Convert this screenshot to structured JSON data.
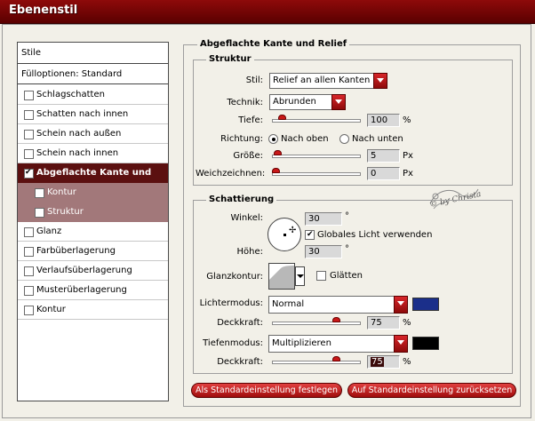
{
  "window": {
    "title": "Ebenenstil"
  },
  "colors": {
    "accent": "#8e0a0a",
    "selected_row": "#5b1010",
    "sub_row": "#a2787a",
    "highlight_color": "#1b2f8a",
    "shadow_color": "#000000"
  },
  "sidebar": {
    "items": [
      {
        "label": "Stile"
      },
      {
        "label": "Fülloptionen: Standard"
      },
      {
        "label": "Schlagschatten",
        "checked": false
      },
      {
        "label": "Schatten nach innen",
        "checked": false
      },
      {
        "label": "Schein nach außen",
        "checked": false
      },
      {
        "label": "Schein nach innen",
        "checked": false
      },
      {
        "label": "Abgeflachte Kante und Relief",
        "checked": true
      },
      {
        "label": "Kontur",
        "checked": false
      },
      {
        "label": "Struktur",
        "checked": false
      },
      {
        "label": "Glanz",
        "checked": false
      },
      {
        "label": "Farbüberlagerung",
        "checked": false
      },
      {
        "label": "Verlaufsüberlagerung",
        "checked": false
      },
      {
        "label": "Musterüberlagerung",
        "checked": false
      },
      {
        "label": "Kontur",
        "checked": false
      }
    ]
  },
  "panel": {
    "title": "Abgeflachte Kante und Relief",
    "structure": {
      "title": "Struktur",
      "style_label": "Stil:",
      "style_value": "Relief an allen Kanten",
      "technique_label": "Technik:",
      "technique_value": "Abrunden",
      "depth_label": "Tiefe:",
      "depth_value": "100",
      "depth_unit": "%",
      "depth_level": 0.08,
      "direction_label": "Richtung:",
      "direction_up": "Nach oben",
      "direction_down": "Nach unten",
      "size_label": "Größe:",
      "size_value": "5",
      "size_unit": "Px",
      "size_level": 0.02,
      "soften_label": "Weichzeichnen:",
      "soften_value": "0",
      "soften_unit": "Px",
      "soften_level": 0.0
    },
    "shading": {
      "title": "Schattierung",
      "angle_label": "Winkel:",
      "angle_value": "30",
      "angle_unit": "°",
      "global_light_label": "Globales Licht verwenden",
      "altitude_label": "Höhe:",
      "altitude_value": "30",
      "altitude_unit": "°",
      "gloss_contour_label": "Glanzkontur:",
      "antialias_label": "Glätten",
      "highlight_mode_label": "Lichtermodus:",
      "highlight_mode_value": "Normal",
      "highlight_opacity_label": "Deckkraft:",
      "highlight_opacity_value": "75",
      "highlight_opacity_unit": "%",
      "highlight_opacity_level": 0.75,
      "shadow_mode_label": "Tiefenmodus:",
      "shadow_mode_value": "Multiplizieren",
      "shadow_opacity_label": "Deckkraft:",
      "shadow_opacity_value": "75",
      "shadow_opacity_unit": "%",
      "shadow_opacity_level": 0.75
    },
    "buttons": {
      "make_default": "Als Standardeinstellung festlegen",
      "reset_default": "Auf Standardeinstellung zurücksetzen"
    },
    "watermark": "© by Christa"
  }
}
